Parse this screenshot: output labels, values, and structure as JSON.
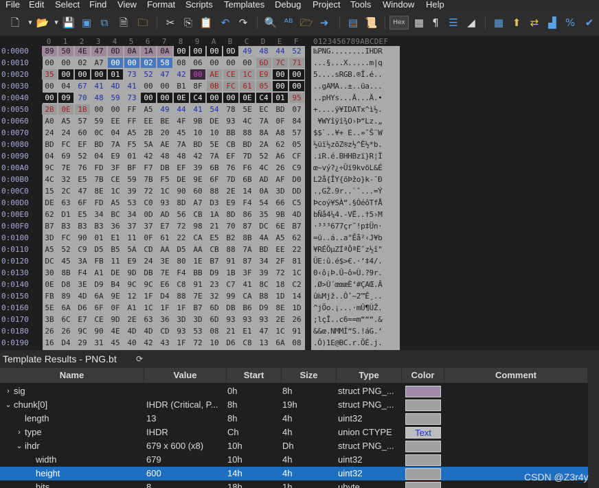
{
  "menu": [
    "File",
    "Edit",
    "Select",
    "Find",
    "View",
    "Format",
    "Scripts",
    "Templates",
    "Debug",
    "Project",
    "Tools",
    "Window",
    "Help"
  ],
  "toolbar": {
    "icons": [
      "new-file-icon",
      "dropdown-arrow-icon",
      "open-folder-icon",
      "dropdown-arrow-icon",
      "save-icon",
      "save-all-icon",
      "save-as-icon",
      "close-file-icon",
      "open-folder-alt-icon",
      "cut-icon",
      "copy-icon",
      "paste-icon",
      "undo-icon",
      "redo-icon",
      "find-icon",
      "replace-icon",
      "find-in-files-icon",
      "goto-icon",
      "template-icon",
      "script-icon",
      "hex-toggle-icon",
      "pilcrow-icon",
      "columns-icon",
      "highlight-icon",
      "calculator-icon",
      "import-icon",
      "compare-icon",
      "histogram-icon",
      "checksum-icon",
      "check-icon"
    ],
    "hex_label": "Hex"
  },
  "editor": {
    "column_headers": [
      "0",
      "1",
      "2",
      "3",
      "4",
      "5",
      "6",
      "7",
      "8",
      "9",
      "A",
      "B",
      "C",
      "D",
      "E",
      "F"
    ],
    "ascii_header": "0123456789ABCDEF",
    "rows": [
      {
        "addr": "0:0000",
        "bytes": [
          "89",
          "50",
          "4E",
          "47",
          "0D",
          "0A",
          "1A",
          "0A",
          "00",
          "00",
          "00",
          "0D",
          "49",
          "48",
          "44",
          "52"
        ],
        "ascii": "‰PNG........IHDR"
      },
      {
        "addr": "0:0010",
        "bytes": [
          "00",
          "00",
          "02",
          "A7",
          "00",
          "00",
          "02",
          "58",
          "08",
          "06",
          "00",
          "00",
          "00",
          "6D",
          "7C",
          "71"
        ],
        "ascii": "...§...X.....m|q"
      },
      {
        "addr": "0:0020",
        "bytes": [
          "35",
          "00",
          "00",
          "00",
          "01",
          "73",
          "52",
          "47",
          "42",
          "00",
          "AE",
          "CE",
          "1C",
          "E9",
          "00",
          "00"
        ],
        "ascii": "5....sRGB.®Î.é.."
      },
      {
        "addr": "0:0030",
        "bytes": [
          "00",
          "04",
          "67",
          "41",
          "4D",
          "41",
          "00",
          "00",
          "B1",
          "8F",
          "0B",
          "FC",
          "61",
          "05",
          "00",
          "00"
        ],
        "ascii": "..gAMA..±..üa..."
      },
      {
        "addr": "0:0040",
        "bytes": [
          "00",
          "09",
          "70",
          "48",
          "59",
          "73",
          "00",
          "00",
          "0E",
          "C4",
          "00",
          "00",
          "0E",
          "C4",
          "01",
          "95"
        ],
        "ascii": "..pHYs...Ä...Ä.•"
      },
      {
        "addr": "0:0050",
        "bytes": [
          "2B",
          "0E",
          "1B",
          "00",
          "00",
          "FF",
          "A5",
          "49",
          "44",
          "41",
          "54",
          "78",
          "5E",
          "EC",
          "BD",
          "07"
        ],
        "ascii": "+....ÿ¥IDATx^ì½."
      },
      {
        "addr": "0:0060",
        "bytes": [
          "A0",
          "A5",
          "57",
          "59",
          "EE",
          "FF",
          "EE",
          "BE",
          "4F",
          "9B",
          "DE",
          "93",
          "4C",
          "7A",
          "0F",
          "84"
        ],
        "ascii": " ¥WYîÿî¾O›Þ“Lz.„"
      },
      {
        "addr": "0:0070",
        "bytes": [
          "24",
          "24",
          "60",
          "0C",
          "04",
          "A5",
          "2B",
          "20",
          "45",
          "10",
          "10",
          "BB",
          "88",
          "8A",
          "A8",
          "57"
        ],
        "ascii": "$$`..¥+ E..»ˆŠ¨W"
      },
      {
        "addr": "0:0080",
        "bytes": [
          "BD",
          "FC",
          "EF",
          "BD",
          "7A",
          "F5",
          "5A",
          "AE",
          "7A",
          "BD",
          "5E",
          "CB",
          "BD",
          "2A",
          "62",
          "05"
        ],
        "ascii": "½üï½zõZ®z½^Ë½*b."
      },
      {
        "addr": "0:0090",
        "bytes": [
          "04",
          "69",
          "52",
          "04",
          "E9",
          "01",
          "42",
          "48",
          "48",
          "42",
          "7A",
          "EF",
          "7D",
          "52",
          "A6",
          "CF"
        ],
        "ascii": ".iR.é.BHHBzï}R¦Ï"
      },
      {
        "addr": "0:00A0",
        "bytes": [
          "9C",
          "7E",
          "76",
          "FD",
          "3F",
          "BF",
          "F7",
          "DB",
          "EF",
          "39",
          "6B",
          "76",
          "F6",
          "4C",
          "26",
          "C9"
        ],
        "ascii": "œ~vý?¿÷Ûï9kvöL&É"
      },
      {
        "addr": "0:00B0",
        "bytes": [
          "4C",
          "32",
          "E5",
          "7B",
          "CE",
          "59",
          "7B",
          "F5",
          "DE",
          "9E",
          "6F",
          "7D",
          "6B",
          "AD",
          "AF",
          "D0"
        ],
        "ascii": "L2å{ÎY{õÞžo}k-¯Ð"
      },
      {
        "addr": "0:00C0",
        "bytes": [
          "15",
          "2C",
          "47",
          "8E",
          "1C",
          "39",
          "72",
          "1C",
          "90",
          "60",
          "88",
          "2E",
          "14",
          "0A",
          "3D",
          "DD"
        ],
        "ascii": ".,GŽ.9r..`ˆ...=Ý"
      },
      {
        "addr": "0:00D0",
        "bytes": [
          "DE",
          "63",
          "6F",
          "FD",
          "A5",
          "53",
          "C0",
          "93",
          "8D",
          "A7",
          "D3",
          "E9",
          "F4",
          "54",
          "66",
          "C5"
        ],
        "ascii": "Þcoý¥SÀ“.§ÓéôTfÅ"
      },
      {
        "addr": "0:00E0",
        "bytes": [
          "62",
          "D1",
          "E5",
          "34",
          "BC",
          "34",
          "0D",
          "AD",
          "56",
          "CB",
          "1A",
          "8D",
          "86",
          "35",
          "9B",
          "4D"
        ],
        "ascii": "bÑå4¼4.-VË..†5›M"
      },
      {
        "addr": "0:00F0",
        "bytes": [
          "B7",
          "B3",
          "B3",
          "B3",
          "36",
          "37",
          "37",
          "E7",
          "72",
          "98",
          "21",
          "70",
          "87",
          "DC",
          "6E",
          "B7"
        ],
        "ascii": "·³³³677çr˜!p‡Ün·"
      },
      {
        "addr": "0:0100",
        "bytes": [
          "3D",
          "FC",
          "90",
          "01",
          "E1",
          "11",
          "0F",
          "61",
          "22",
          "CA",
          "E5",
          "B2",
          "8B",
          "4A",
          "A5",
          "62"
        ],
        "ascii": "=ü..á..a\"Êå²‹J¥b"
      },
      {
        "addr": "0:0110",
        "bytes": [
          "A5",
          "52",
          "C9",
          "D5",
          "B5",
          "5A",
          "CD",
          "AA",
          "D5",
          "AA",
          "CB",
          "88",
          "7A",
          "BD",
          "EE",
          "22"
        ],
        "ascii": "¥RÉÕµZÍªÕªËˆz½î\""
      },
      {
        "addr": "0:0120",
        "bytes": [
          "DC",
          "45",
          "3A",
          "FB",
          "11",
          "E9",
          "24",
          "3E",
          "80",
          "1E",
          "B7",
          "91",
          "87",
          "34",
          "2F",
          "81"
        ],
        "ascii": "ÜE:û.é$>€.·‘‡4/."
      },
      {
        "addr": "0:0130",
        "bytes": [
          "30",
          "8B",
          "F4",
          "A1",
          "DE",
          "9D",
          "DB",
          "7E",
          "F4",
          "BB",
          "D9",
          "1B",
          "3F",
          "39",
          "72",
          "1C"
        ],
        "ascii": "0‹ô¡Þ.Û~ô»Ù.?9r."
      },
      {
        "addr": "0:0140",
        "bytes": [
          "0E",
          "D8",
          "3E",
          "D9",
          "B4",
          "9C",
          "9C",
          "E6",
          "C8",
          "91",
          "23",
          "C7",
          "41",
          "8C",
          "18",
          "C2"
        ],
        "ascii": ".Ø>Ù´œœæÈ‘#ÇAŒ.Â"
      },
      {
        "addr": "0:0150",
        "bytes": [
          "FB",
          "89",
          "4D",
          "6A",
          "9E",
          "12",
          "1F",
          "D4",
          "88",
          "7E",
          "32",
          "99",
          "CA",
          "B8",
          "1D",
          "14"
        ],
        "ascii": "û‰Mjž..Ôˆ~2™Ê¸.."
      },
      {
        "addr": "0:0160",
        "bytes": [
          "5E",
          "6A",
          "D6",
          "6F",
          "0F",
          "A1",
          "1C",
          "1F",
          "1F",
          "B7",
          "6D",
          "DB",
          "B6",
          "D9",
          "8E",
          "1D"
        ],
        "ascii": "^jÖo.¡...·mÛ¶ÙŽ."
      },
      {
        "addr": "0:0170",
        "bytes": [
          "3B",
          "6C",
          "E7",
          "CE",
          "9D",
          "2E",
          "63",
          "36",
          "3D",
          "3D",
          "6D",
          "93",
          "93",
          "93",
          "2E",
          "26"
        ],
        "ascii": ";lçÎ..c6==m“““.&"
      },
      {
        "addr": "0:0180",
        "bytes": [
          "26",
          "26",
          "9C",
          "90",
          "4E",
          "4D",
          "4D",
          "CD",
          "93",
          "53",
          "08",
          "21",
          "E1",
          "47",
          "1C",
          "91"
        ],
        "ascii": "&&œ.NMMÍ“S.!áG.‘"
      },
      {
        "addr": "0:0190",
        "bytes": [
          "16",
          "D4",
          "29",
          "31",
          "45",
          "40",
          "42",
          "43",
          "1F",
          "72",
          "10",
          "D6",
          "C8",
          "13",
          "6A",
          "08"
        ],
        "ascii": ".Ô)1E@BC.r.ÖÈ.j."
      }
    ]
  },
  "template": {
    "title": "Template Results - PNG.bt",
    "columns": [
      "Name",
      "Value",
      "Start",
      "Size",
      "Type",
      "Color",
      "Comment"
    ],
    "rows": [
      {
        "name": "sig",
        "value": "",
        "start": "0h",
        "size": "8h",
        "type": "struct PNG_...",
        "color_text": "",
        "color": "#a08aa8",
        "twisty": ">",
        "indent": 0,
        "selected": false
      },
      {
        "name": "chunk[0]",
        "value": "IHDR  (Critical, P...",
        "start": "8h",
        "size": "19h",
        "type": "struct PNG_...",
        "color_text": "",
        "color": "#a0a0a0",
        "twisty": "v",
        "indent": 0,
        "selected": false
      },
      {
        "name": "length",
        "value": "13",
        "start": "8h",
        "size": "4h",
        "type": "uint32",
        "color_text": "",
        "color": "#a0a0a0",
        "twisty": "",
        "indent": 1,
        "selected": false
      },
      {
        "name": "type",
        "value": "IHDR",
        "start": "Ch",
        "size": "4h",
        "type": "union CTYPE",
        "color_text": "Text",
        "color": "#a0a0a0",
        "twisty": ">",
        "indent": 1,
        "selected": false
      },
      {
        "name": "ihdr",
        "value": "679 x 600 (x8)",
        "start": "10h",
        "size": "Dh",
        "type": "struct PNG_...",
        "color_text": "",
        "color": "#a0a0a0",
        "twisty": "v",
        "indent": 1,
        "selected": false
      },
      {
        "name": "width",
        "value": "679",
        "start": "10h",
        "size": "4h",
        "type": "uint32",
        "color_text": "",
        "color": "#a0a0a0",
        "twisty": "",
        "indent": 2,
        "selected": false
      },
      {
        "name": "height",
        "value": "600",
        "start": "14h",
        "size": "4h",
        "type": "uint32",
        "color_text": "",
        "color": "#a0a0a0",
        "twisty": "",
        "indent": 2,
        "selected": true
      },
      {
        "name": "bits",
        "value": "8",
        "start": "18h",
        "size": "1h",
        "type": "ubyte",
        "color_text": "",
        "color": "#a0a0a0",
        "twisty": "",
        "indent": 2,
        "selected": false
      }
    ]
  },
  "watermark": "CSDN @Z3r4y"
}
